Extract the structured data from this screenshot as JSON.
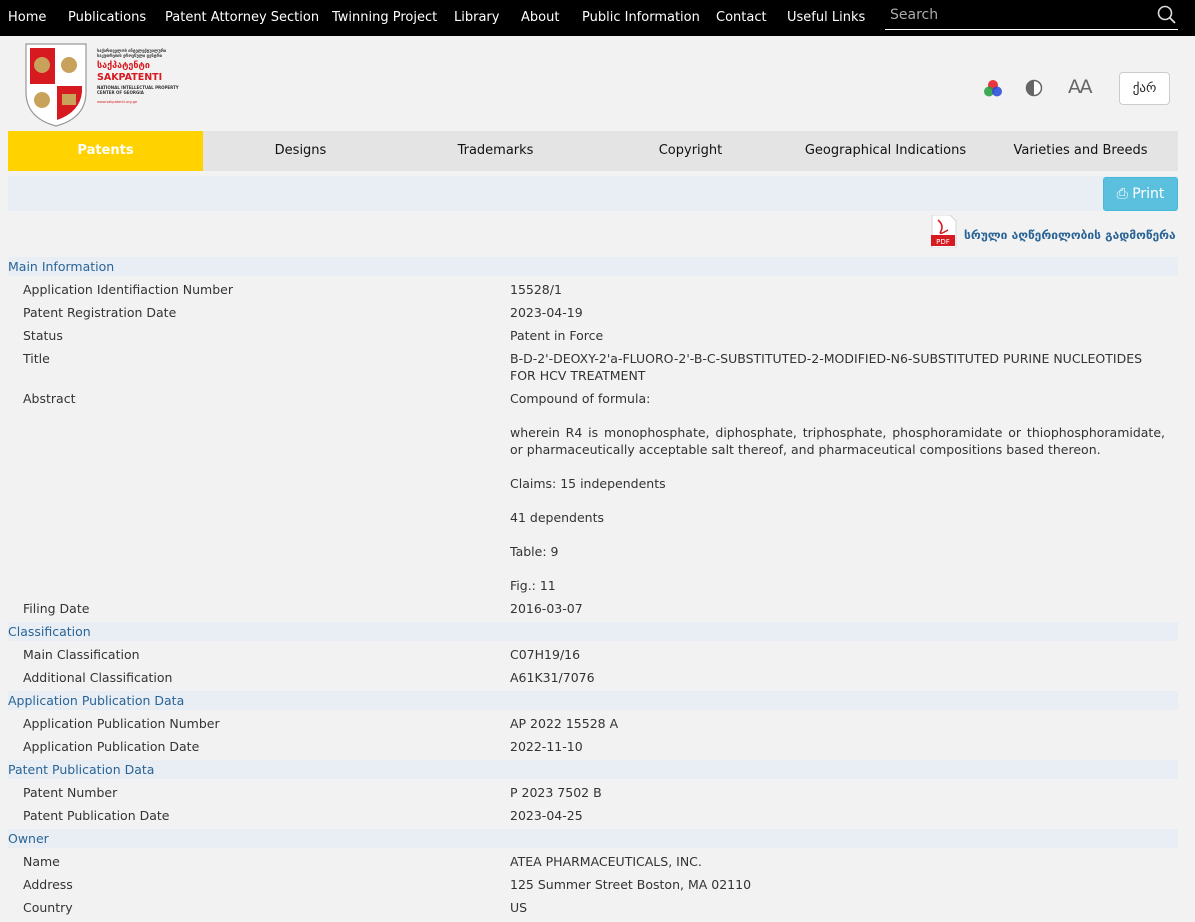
{
  "topnav": {
    "items": [
      "Home",
      "Publications",
      "Patent Attorney Section",
      "Twinning Project",
      "Library",
      "About",
      "Public Information",
      "Contact",
      "Useful Links"
    ],
    "search_placeholder": "Search"
  },
  "logo": {
    "lines_ka": [
      "საქართველოს ინტელექტუალური",
      "საკუთრების ეროვნული ცენტრი"
    ],
    "brand_ka": "საქპატენტი",
    "brand_en": "SAKPATENTI",
    "subtitle": [
      "NATIONAL INTELLECTUAL PROPERTY",
      "CENTER OF GEORGIA"
    ],
    "url": "www.sakpatenti.org.ge"
  },
  "tools": {
    "color_icon": "color-icon",
    "contrast_icon": "contrast-icon",
    "font_size_icon": "font-size-icon",
    "font_size_glyph": "AA",
    "language": "ქარ"
  },
  "tabs": [
    "Patents",
    "Designs",
    "Trademarks",
    "Copyright",
    "Geographical Indications",
    "Varieties and Breeds"
  ],
  "active_tab": "Patents",
  "print": {
    "label": "Print",
    "icon": "print-icon"
  },
  "pdf": {
    "icon": "pdf-icon",
    "icon_text": "PDF",
    "label": "სრული აღწერილობის გადმოწერა"
  },
  "sections": {
    "main": {
      "title": "Main Information",
      "rows": [
        {
          "label": "Application Identifiaction Number",
          "value": "15528/1"
        },
        {
          "label": "Patent Registration Date",
          "value": "2023-04-19"
        },
        {
          "label": "Status",
          "value": "Patent in Force"
        },
        {
          "label": "Title",
          "value": "B-D-2'-DEOXY-2'a-FLUORO-2'-B-C-SUBSTITUTED-2-MODIFIED-N6-SUBSTITUTED PURINE NUCLEOTIDES FOR HCV TREATMENT"
        },
        {
          "label": "Abstract",
          "value": ""
        },
        {
          "label": "Filing Date",
          "value": "2016-03-07"
        }
      ],
      "abstract": [
        "Compound of formula:",
        "wherein R4 is monophosphate, diphosphate, triphosphate, phosphoramidate or thiophosphoramidate, or pharmaceutically acceptable salt thereof, and pharmaceutical compositions based thereon.",
        "Claims: 15 independents",
        "41 dependents",
        "Table: 9",
        "Fig.: 11"
      ]
    },
    "classification": {
      "title": "Classification",
      "rows": [
        {
          "label": "Main Classification",
          "value": "C07H19/16"
        },
        {
          "label": "Additional Classification",
          "value": "A61K31/7076"
        }
      ]
    },
    "app_pub": {
      "title": "Application Publication Data",
      "rows": [
        {
          "label": "Application Publication Number",
          "value": "AP 2022 15528 A"
        },
        {
          "label": "Application Publication Date",
          "value": "2022-11-10"
        }
      ]
    },
    "patent_pub": {
      "title": "Patent Publication Data",
      "rows": [
        {
          "label": "Patent Number",
          "value": "P 2023 7502 B"
        },
        {
          "label": "Patent Publication Date",
          "value": "2023-04-25"
        }
      ]
    },
    "owner": {
      "title": "Owner",
      "rows": [
        {
          "label": "Name",
          "value": "ATEA PHARMACEUTICALS, INC."
        },
        {
          "label": "Address",
          "value": "125 Summer Street Boston, MA 02110"
        },
        {
          "label": "Country",
          "value": "US"
        }
      ]
    }
  },
  "colors": {
    "nav_bg": "#000000",
    "active_tab": "#ffd200",
    "link": "#2a6496",
    "print_btn": "#5bc0de",
    "brand_red": "#d71920"
  }
}
